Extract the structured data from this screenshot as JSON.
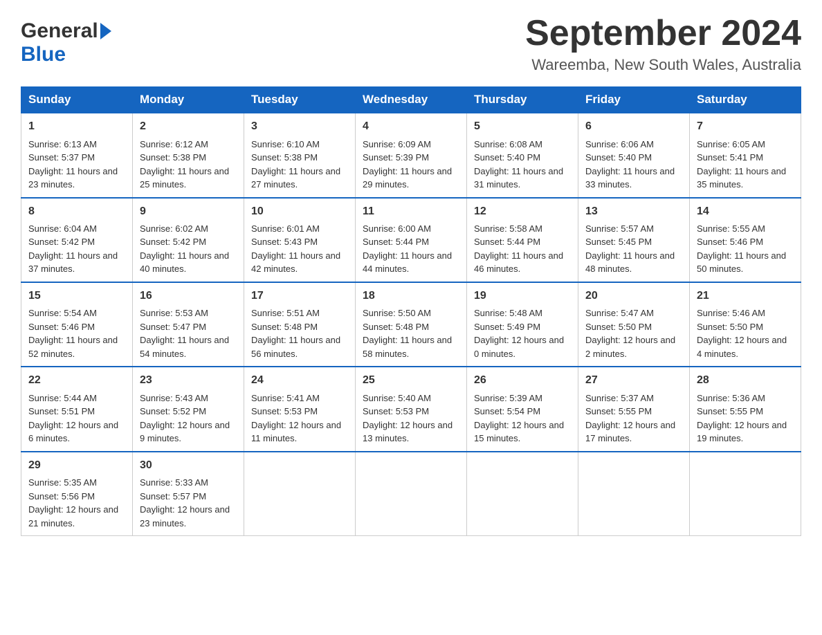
{
  "header": {
    "logo_general": "General",
    "logo_blue": "Blue",
    "title": "September 2024",
    "location": "Wareemba, New South Wales, Australia"
  },
  "days_of_week": [
    "Sunday",
    "Monday",
    "Tuesday",
    "Wednesday",
    "Thursday",
    "Friday",
    "Saturday"
  ],
  "weeks": [
    [
      {
        "day": "1",
        "sunrise": "Sunrise: 6:13 AM",
        "sunset": "Sunset: 5:37 PM",
        "daylight": "Daylight: 11 hours and 23 minutes."
      },
      {
        "day": "2",
        "sunrise": "Sunrise: 6:12 AM",
        "sunset": "Sunset: 5:38 PM",
        "daylight": "Daylight: 11 hours and 25 minutes."
      },
      {
        "day": "3",
        "sunrise": "Sunrise: 6:10 AM",
        "sunset": "Sunset: 5:38 PM",
        "daylight": "Daylight: 11 hours and 27 minutes."
      },
      {
        "day": "4",
        "sunrise": "Sunrise: 6:09 AM",
        "sunset": "Sunset: 5:39 PM",
        "daylight": "Daylight: 11 hours and 29 minutes."
      },
      {
        "day": "5",
        "sunrise": "Sunrise: 6:08 AM",
        "sunset": "Sunset: 5:40 PM",
        "daylight": "Daylight: 11 hours and 31 minutes."
      },
      {
        "day": "6",
        "sunrise": "Sunrise: 6:06 AM",
        "sunset": "Sunset: 5:40 PM",
        "daylight": "Daylight: 11 hours and 33 minutes."
      },
      {
        "day": "7",
        "sunrise": "Sunrise: 6:05 AM",
        "sunset": "Sunset: 5:41 PM",
        "daylight": "Daylight: 11 hours and 35 minutes."
      }
    ],
    [
      {
        "day": "8",
        "sunrise": "Sunrise: 6:04 AM",
        "sunset": "Sunset: 5:42 PM",
        "daylight": "Daylight: 11 hours and 37 minutes."
      },
      {
        "day": "9",
        "sunrise": "Sunrise: 6:02 AM",
        "sunset": "Sunset: 5:42 PM",
        "daylight": "Daylight: 11 hours and 40 minutes."
      },
      {
        "day": "10",
        "sunrise": "Sunrise: 6:01 AM",
        "sunset": "Sunset: 5:43 PM",
        "daylight": "Daylight: 11 hours and 42 minutes."
      },
      {
        "day": "11",
        "sunrise": "Sunrise: 6:00 AM",
        "sunset": "Sunset: 5:44 PM",
        "daylight": "Daylight: 11 hours and 44 minutes."
      },
      {
        "day": "12",
        "sunrise": "Sunrise: 5:58 AM",
        "sunset": "Sunset: 5:44 PM",
        "daylight": "Daylight: 11 hours and 46 minutes."
      },
      {
        "day": "13",
        "sunrise": "Sunrise: 5:57 AM",
        "sunset": "Sunset: 5:45 PM",
        "daylight": "Daylight: 11 hours and 48 minutes."
      },
      {
        "day": "14",
        "sunrise": "Sunrise: 5:55 AM",
        "sunset": "Sunset: 5:46 PM",
        "daylight": "Daylight: 11 hours and 50 minutes."
      }
    ],
    [
      {
        "day": "15",
        "sunrise": "Sunrise: 5:54 AM",
        "sunset": "Sunset: 5:46 PM",
        "daylight": "Daylight: 11 hours and 52 minutes."
      },
      {
        "day": "16",
        "sunrise": "Sunrise: 5:53 AM",
        "sunset": "Sunset: 5:47 PM",
        "daylight": "Daylight: 11 hours and 54 minutes."
      },
      {
        "day": "17",
        "sunrise": "Sunrise: 5:51 AM",
        "sunset": "Sunset: 5:48 PM",
        "daylight": "Daylight: 11 hours and 56 minutes."
      },
      {
        "day": "18",
        "sunrise": "Sunrise: 5:50 AM",
        "sunset": "Sunset: 5:48 PM",
        "daylight": "Daylight: 11 hours and 58 minutes."
      },
      {
        "day": "19",
        "sunrise": "Sunrise: 5:48 AM",
        "sunset": "Sunset: 5:49 PM",
        "daylight": "Daylight: 12 hours and 0 minutes."
      },
      {
        "day": "20",
        "sunrise": "Sunrise: 5:47 AM",
        "sunset": "Sunset: 5:50 PM",
        "daylight": "Daylight: 12 hours and 2 minutes."
      },
      {
        "day": "21",
        "sunrise": "Sunrise: 5:46 AM",
        "sunset": "Sunset: 5:50 PM",
        "daylight": "Daylight: 12 hours and 4 minutes."
      }
    ],
    [
      {
        "day": "22",
        "sunrise": "Sunrise: 5:44 AM",
        "sunset": "Sunset: 5:51 PM",
        "daylight": "Daylight: 12 hours and 6 minutes."
      },
      {
        "day": "23",
        "sunrise": "Sunrise: 5:43 AM",
        "sunset": "Sunset: 5:52 PM",
        "daylight": "Daylight: 12 hours and 9 minutes."
      },
      {
        "day": "24",
        "sunrise": "Sunrise: 5:41 AM",
        "sunset": "Sunset: 5:53 PM",
        "daylight": "Daylight: 12 hours and 11 minutes."
      },
      {
        "day": "25",
        "sunrise": "Sunrise: 5:40 AM",
        "sunset": "Sunset: 5:53 PM",
        "daylight": "Daylight: 12 hours and 13 minutes."
      },
      {
        "day": "26",
        "sunrise": "Sunrise: 5:39 AM",
        "sunset": "Sunset: 5:54 PM",
        "daylight": "Daylight: 12 hours and 15 minutes."
      },
      {
        "day": "27",
        "sunrise": "Sunrise: 5:37 AM",
        "sunset": "Sunset: 5:55 PM",
        "daylight": "Daylight: 12 hours and 17 minutes."
      },
      {
        "day": "28",
        "sunrise": "Sunrise: 5:36 AM",
        "sunset": "Sunset: 5:55 PM",
        "daylight": "Daylight: 12 hours and 19 minutes."
      }
    ],
    [
      {
        "day": "29",
        "sunrise": "Sunrise: 5:35 AM",
        "sunset": "Sunset: 5:56 PM",
        "daylight": "Daylight: 12 hours and 21 minutes."
      },
      {
        "day": "30",
        "sunrise": "Sunrise: 5:33 AM",
        "sunset": "Sunset: 5:57 PM",
        "daylight": "Daylight: 12 hours and 23 minutes."
      },
      null,
      null,
      null,
      null,
      null
    ]
  ]
}
